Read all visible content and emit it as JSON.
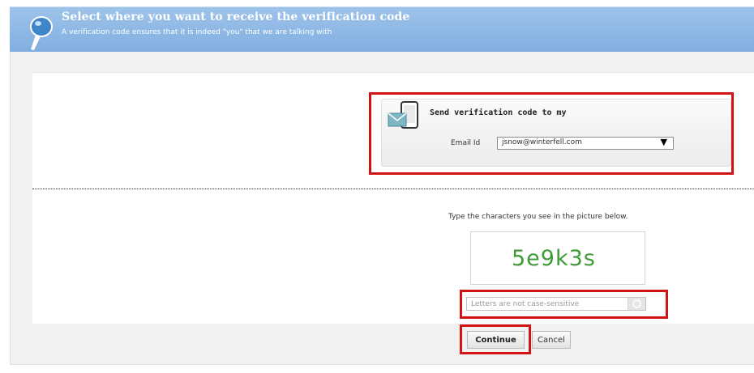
{
  "header": {
    "title": "Select where you want to receive the verification code",
    "subtitle": "A verification code ensures that it is indeed \"you\" that we are talking with",
    "icon": "pin-icon"
  },
  "send_options": {
    "heading": "Send verification code to my",
    "icon": "mobile-mail-icon",
    "email_label": "Email Id",
    "email_value": "jsnow@winterfell.com"
  },
  "captcha": {
    "instruction": "Type the characters you see in the picture below.",
    "image_text": "5e9k3s",
    "input_placeholder": "Letters are not case-sensitive",
    "input_value": "",
    "text_color": "#3f9c35"
  },
  "actions": {
    "continue_label": "Continue",
    "cancel_label": "Cancel"
  },
  "colors": {
    "header_bg": "#80aee0",
    "highlight": "#d11313"
  }
}
